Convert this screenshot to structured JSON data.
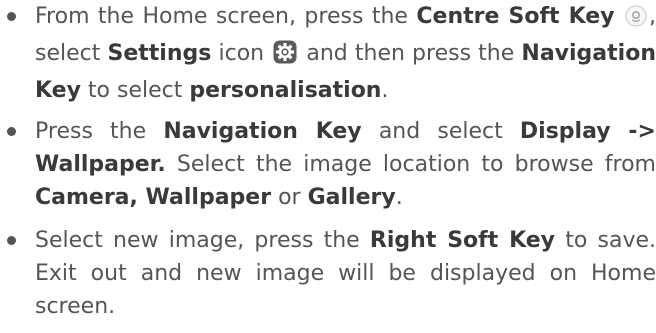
{
  "instructions": {
    "items": [
      {
        "segments": [
          {
            "text": "From the Home screen, press the ",
            "bold": false
          },
          {
            "text": "Centre Soft Key",
            "bold": true
          },
          {
            "icon": "centre-soft-key-icon"
          },
          {
            "text": ", select ",
            "bold": false
          },
          {
            "text": "Settings",
            "bold": true
          },
          {
            "text": " icon ",
            "bold": false
          },
          {
            "icon": "settings-gear-icon"
          },
          {
            "text": " and then press the ",
            "bold": false
          },
          {
            "text": "Navigation Key",
            "bold": true
          },
          {
            "text": " to select ",
            "bold": false
          },
          {
            "text": "personalisation",
            "bold": true
          },
          {
            "text": ".",
            "bold": false
          }
        ]
      },
      {
        "segments": [
          {
            "text": "Press the ",
            "bold": false
          },
          {
            "text": "Navigation Key",
            "bold": true
          },
          {
            "text": " and select ",
            "bold": false
          },
          {
            "text": "Display -> Wallpaper.",
            "bold": true
          },
          {
            "text": " Select the image location to browse from ",
            "bold": false
          },
          {
            "text": "Camera, Wallpaper",
            "bold": true
          },
          {
            "text": " or ",
            "bold": false
          },
          {
            "text": "Gallery",
            "bold": true
          },
          {
            "text": ".",
            "bold": false
          }
        ]
      },
      {
        "segments": [
          {
            "text": "Select new image, press the ",
            "bold": false
          },
          {
            "text": "Right Soft Key",
            "bold": true
          },
          {
            "text": " to save. Exit out and new image will be displayed on Home screen.",
            "bold": false
          }
        ]
      }
    ]
  }
}
